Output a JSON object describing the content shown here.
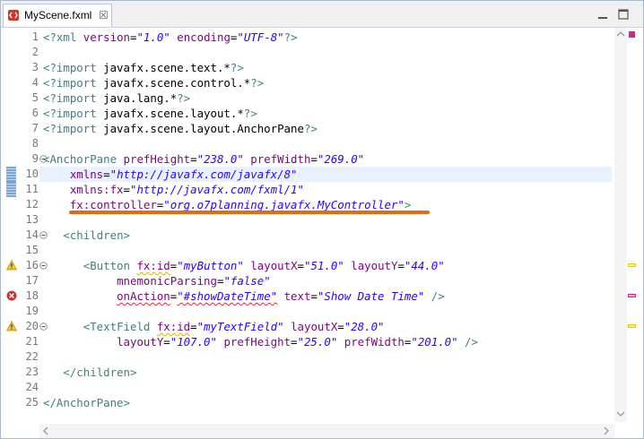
{
  "tab": {
    "title": "MyScene.fxml",
    "close": "☒"
  },
  "lines": [
    {
      "n": "1",
      "marker": "",
      "fold": "",
      "hl": false,
      "tokens": [
        [
          "pi",
          "<?xml "
        ],
        [
          "attr",
          "version"
        ],
        [
          "plain",
          "="
        ],
        [
          "val",
          "\"1.0\""
        ],
        [
          "plain",
          " "
        ],
        [
          "attr",
          "encoding"
        ],
        [
          "plain",
          "="
        ],
        [
          "val",
          "\"UTF-8\""
        ],
        [
          "pi",
          "?>"
        ]
      ]
    },
    {
      "n": "2",
      "marker": "",
      "fold": "",
      "hl": false,
      "tokens": []
    },
    {
      "n": "3",
      "marker": "",
      "fold": "",
      "hl": false,
      "tokens": [
        [
          "pi",
          "<?import "
        ],
        [
          "plain",
          "javafx.scene.text.*"
        ],
        [
          "pi",
          "?>"
        ]
      ]
    },
    {
      "n": "4",
      "marker": "",
      "fold": "",
      "hl": false,
      "tokens": [
        [
          "pi",
          "<?import "
        ],
        [
          "plain",
          "javafx.scene.control.*"
        ],
        [
          "pi",
          "?>"
        ]
      ]
    },
    {
      "n": "5",
      "marker": "",
      "fold": "",
      "hl": false,
      "tokens": [
        [
          "pi",
          "<?import "
        ],
        [
          "plain",
          "java.lang.*"
        ],
        [
          "pi",
          "?>"
        ]
      ]
    },
    {
      "n": "6",
      "marker": "",
      "fold": "",
      "hl": false,
      "tokens": [
        [
          "pi",
          "<?import "
        ],
        [
          "plain",
          "javafx.scene.layout.*"
        ],
        [
          "pi",
          "?>"
        ]
      ]
    },
    {
      "n": "7",
      "marker": "",
      "fold": "",
      "hl": false,
      "tokens": [
        [
          "pi",
          "<?import "
        ],
        [
          "plain",
          "javafx.scene.layout.AnchorPane"
        ],
        [
          "pi",
          "?>"
        ]
      ]
    },
    {
      "n": "8",
      "marker": "",
      "fold": "",
      "hl": false,
      "tokens": []
    },
    {
      "n": "9",
      "marker": "",
      "fold": "minus",
      "hl": false,
      "tokens": [
        [
          "tag",
          "<AnchorPane "
        ],
        [
          "attr",
          "prefHeight"
        ],
        [
          "plain",
          "="
        ],
        [
          "val",
          "\"238.0\""
        ],
        [
          "plain",
          " "
        ],
        [
          "attr",
          "prefWidth"
        ],
        [
          "plain",
          "="
        ],
        [
          "val",
          "\"269.0\""
        ]
      ]
    },
    {
      "n": "10",
      "marker": "sel",
      "fold": "",
      "hl": true,
      "tokens": [
        [
          "plain",
          "    "
        ],
        [
          "attr",
          "xmlns"
        ],
        [
          "plain",
          "="
        ],
        [
          "val",
          "\"http://javafx.com/javafx/8\""
        ]
      ]
    },
    {
      "n": "11",
      "marker": "sel",
      "fold": "",
      "hl": false,
      "tokens": [
        [
          "plain",
          "    "
        ],
        [
          "attr",
          "xmlns:fx"
        ],
        [
          "plain",
          "="
        ],
        [
          "val",
          "\"http://javafx.com/fxml/1\""
        ]
      ]
    },
    {
      "n": "12",
      "marker": "",
      "fold": "",
      "hl": false,
      "tokens": [
        [
          "plain",
          "    "
        ],
        [
          "attr",
          "fx:controller"
        ],
        [
          "plain",
          "="
        ],
        [
          "val",
          "\"org.o7planning.javafx.MyController\""
        ],
        [
          "tag",
          ">"
        ]
      ]
    },
    {
      "n": "13",
      "marker": "",
      "fold": "",
      "hl": false,
      "tokens": []
    },
    {
      "n": "14",
      "marker": "",
      "fold": "minus",
      "hl": false,
      "tokens": [
        [
          "plain",
          "   "
        ],
        [
          "tag",
          "<children>"
        ]
      ]
    },
    {
      "n": "15",
      "marker": "",
      "fold": "",
      "hl": false,
      "tokens": []
    },
    {
      "n": "16",
      "marker": "warn",
      "fold": "minus",
      "hl": false,
      "tokens": [
        [
          "plain",
          "      "
        ],
        [
          "tag",
          "<Button "
        ],
        [
          "attrsq",
          "fx:id"
        ],
        [
          "plain",
          "="
        ],
        [
          "val",
          "\"myButton\""
        ],
        [
          "plain",
          " "
        ],
        [
          "attr",
          "layoutX"
        ],
        [
          "plain",
          "="
        ],
        [
          "val",
          "\"51.0\""
        ],
        [
          "plain",
          " "
        ],
        [
          "attr",
          "layoutY"
        ],
        [
          "plain",
          "="
        ],
        [
          "val",
          "\"44.0\""
        ]
      ]
    },
    {
      "n": "17",
      "marker": "",
      "fold": "",
      "hl": false,
      "tokens": [
        [
          "plain",
          "           "
        ],
        [
          "attr",
          "mnemonicParsing"
        ],
        [
          "plain",
          "="
        ],
        [
          "val",
          "\"false\""
        ]
      ]
    },
    {
      "n": "18",
      "marker": "error",
      "fold": "",
      "hl": false,
      "tokens": [
        [
          "plain",
          "           "
        ],
        [
          "attrsqr",
          "onAction"
        ],
        [
          "plain",
          "="
        ],
        [
          "valsqr",
          "\"#showDateTime\""
        ],
        [
          "plain",
          " "
        ],
        [
          "attr",
          "text"
        ],
        [
          "plain",
          "="
        ],
        [
          "val",
          "\"Show Date Time\""
        ],
        [
          "plain",
          " "
        ],
        [
          "tag",
          "/>"
        ]
      ]
    },
    {
      "n": "19",
      "marker": "",
      "fold": "",
      "hl": false,
      "tokens": []
    },
    {
      "n": "20",
      "marker": "warn",
      "fold": "minus",
      "hl": false,
      "tokens": [
        [
          "plain",
          "      "
        ],
        [
          "tag",
          "<TextField "
        ],
        [
          "attrsq",
          "fx:id"
        ],
        [
          "plain",
          "="
        ],
        [
          "val",
          "\"myTextField\""
        ],
        [
          "plain",
          " "
        ],
        [
          "attr",
          "layoutX"
        ],
        [
          "plain",
          "="
        ],
        [
          "val",
          "\"28.0\""
        ]
      ]
    },
    {
      "n": "21",
      "marker": "",
      "fold": "",
      "hl": false,
      "tokens": [
        [
          "plain",
          "           "
        ],
        [
          "attr",
          "layoutY"
        ],
        [
          "plain",
          "="
        ],
        [
          "val",
          "\"107.0\""
        ],
        [
          "plain",
          " "
        ],
        [
          "attr",
          "prefHeight"
        ],
        [
          "plain",
          "="
        ],
        [
          "val",
          "\"25.0\""
        ],
        [
          "plain",
          " "
        ],
        [
          "attr",
          "prefWidth"
        ],
        [
          "plain",
          "="
        ],
        [
          "val",
          "\"201.0\""
        ],
        [
          "plain",
          " "
        ],
        [
          "tag",
          "/>"
        ]
      ]
    },
    {
      "n": "22",
      "marker": "",
      "fold": "",
      "hl": false,
      "tokens": []
    },
    {
      "n": "23",
      "marker": "",
      "fold": "",
      "hl": false,
      "tokens": [
        [
          "plain",
          "   "
        ],
        [
          "tag",
          "</children>"
        ]
      ]
    },
    {
      "n": "24",
      "marker": "",
      "fold": "",
      "hl": false,
      "tokens": []
    },
    {
      "n": "25",
      "marker": "",
      "fold": "",
      "hl": false,
      "tokens": [
        [
          "tag",
          "</AnchorPane>"
        ]
      ]
    }
  ],
  "overview_marks": [
    {
      "line": 16,
      "type": "warning",
      "color": "#f0c800"
    },
    {
      "line": 18,
      "type": "error",
      "color": "#e0208a"
    },
    {
      "line": 20,
      "type": "warning",
      "color": "#f0c800"
    }
  ],
  "colors": {
    "accent_underline": "#e86a10",
    "error_marker": "#e0208a"
  }
}
